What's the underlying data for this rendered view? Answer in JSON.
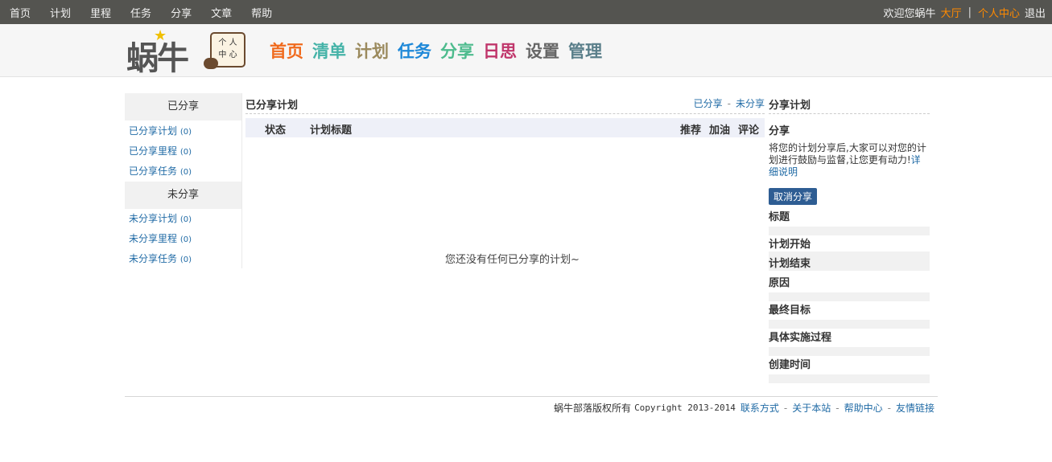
{
  "topbar": {
    "nav": [
      "首页",
      "计划",
      "里程",
      "任务",
      "分享",
      "文章",
      "帮助"
    ],
    "welcome": "欢迎您蜗牛",
    "lobby": "大厅",
    "separator": "|",
    "personal_center": "个人中心",
    "logout": "退出"
  },
  "logo": {
    "text": "蜗牛",
    "card_line1": "个 人",
    "card_line2": "中 心"
  },
  "mainnav": [
    {
      "label": "首页",
      "color": "#f06a1d"
    },
    {
      "label": "清单",
      "color": "#45b3a8"
    },
    {
      "label": "计划",
      "color": "#9b8a5d"
    },
    {
      "label": "任务",
      "color": "#1e88d8"
    },
    {
      "label": "分享",
      "color": "#4dbb8d"
    },
    {
      "label": "日思",
      "color": "#c0366b"
    },
    {
      "label": "设置",
      "color": "#666666"
    },
    {
      "label": "管理",
      "color": "#5a7f8a"
    }
  ],
  "sidebar": {
    "shared_header": "已分享",
    "shared_items": [
      {
        "label": "已分享计划",
        "count": "(0)"
      },
      {
        "label": "已分享里程",
        "count": "(0)"
      },
      {
        "label": "已分享任务",
        "count": "(0)"
      }
    ],
    "unshared_header": "未分享",
    "unshared_items": [
      {
        "label": "未分享计划",
        "count": "(0)"
      },
      {
        "label": "未分享里程",
        "count": "(0)"
      },
      {
        "label": "未分享任务",
        "count": "(0)"
      }
    ]
  },
  "main": {
    "title": "已分享计划",
    "link_shared": "已分享",
    "link_dash": "-",
    "link_unshared": "未分享",
    "columns": {
      "status": "状态",
      "plan_title": "计划标题",
      "recommend": "推荐",
      "cheer": "加油",
      "comment": "评论"
    },
    "empty_message": "您还没有任何已分享的计划~"
  },
  "panel": {
    "title": "分享计划",
    "share_label": "分享",
    "description": "将您的计划分享后,大家可以对您的计划进行鼓励与监督,让您更有动力!",
    "detail_link": "详细说明",
    "cancel_button": "取消分享",
    "fields": [
      "标题",
      "计划开始",
      "计划结束",
      "原因",
      "最终目标",
      "具体实施过程",
      "创建时间"
    ]
  },
  "footer": {
    "owner": "蜗牛部落版权所有",
    "copyright": "Copyright 2013-2014",
    "links": [
      "联系方式",
      "关于本站",
      "帮助中心",
      "友情链接"
    ],
    "dash": "-"
  }
}
